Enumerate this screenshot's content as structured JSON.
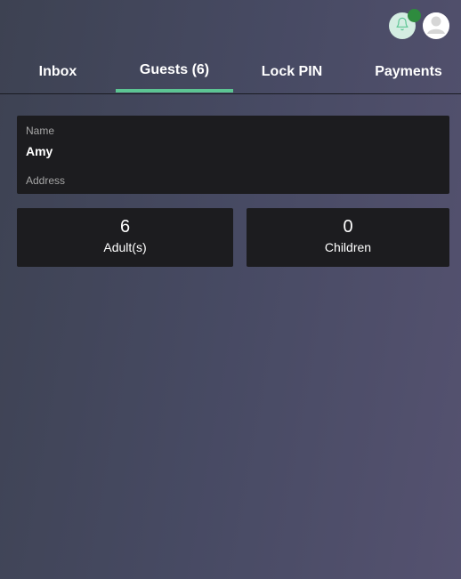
{
  "header": {
    "icons": {
      "notification": "bell-icon",
      "profile": "user-avatar-icon"
    },
    "colors": {
      "bell_bg": "#d4ede2",
      "notification_dot": "#2e8b3e",
      "tab_active_underline": "#5cc593"
    }
  },
  "tabs": [
    {
      "label": "Inbox",
      "active": false
    },
    {
      "label": "Guests (6)",
      "active": true
    },
    {
      "label": "Lock PIN",
      "active": false
    },
    {
      "label": "Payments",
      "active": false
    }
  ],
  "guest": {
    "name_label": "Name",
    "name_value": "Amy",
    "address_label": "Address"
  },
  "counts": {
    "adults_value": "6",
    "adults_label": "Adult(s)",
    "children_value": "0",
    "children_label": "Children"
  }
}
